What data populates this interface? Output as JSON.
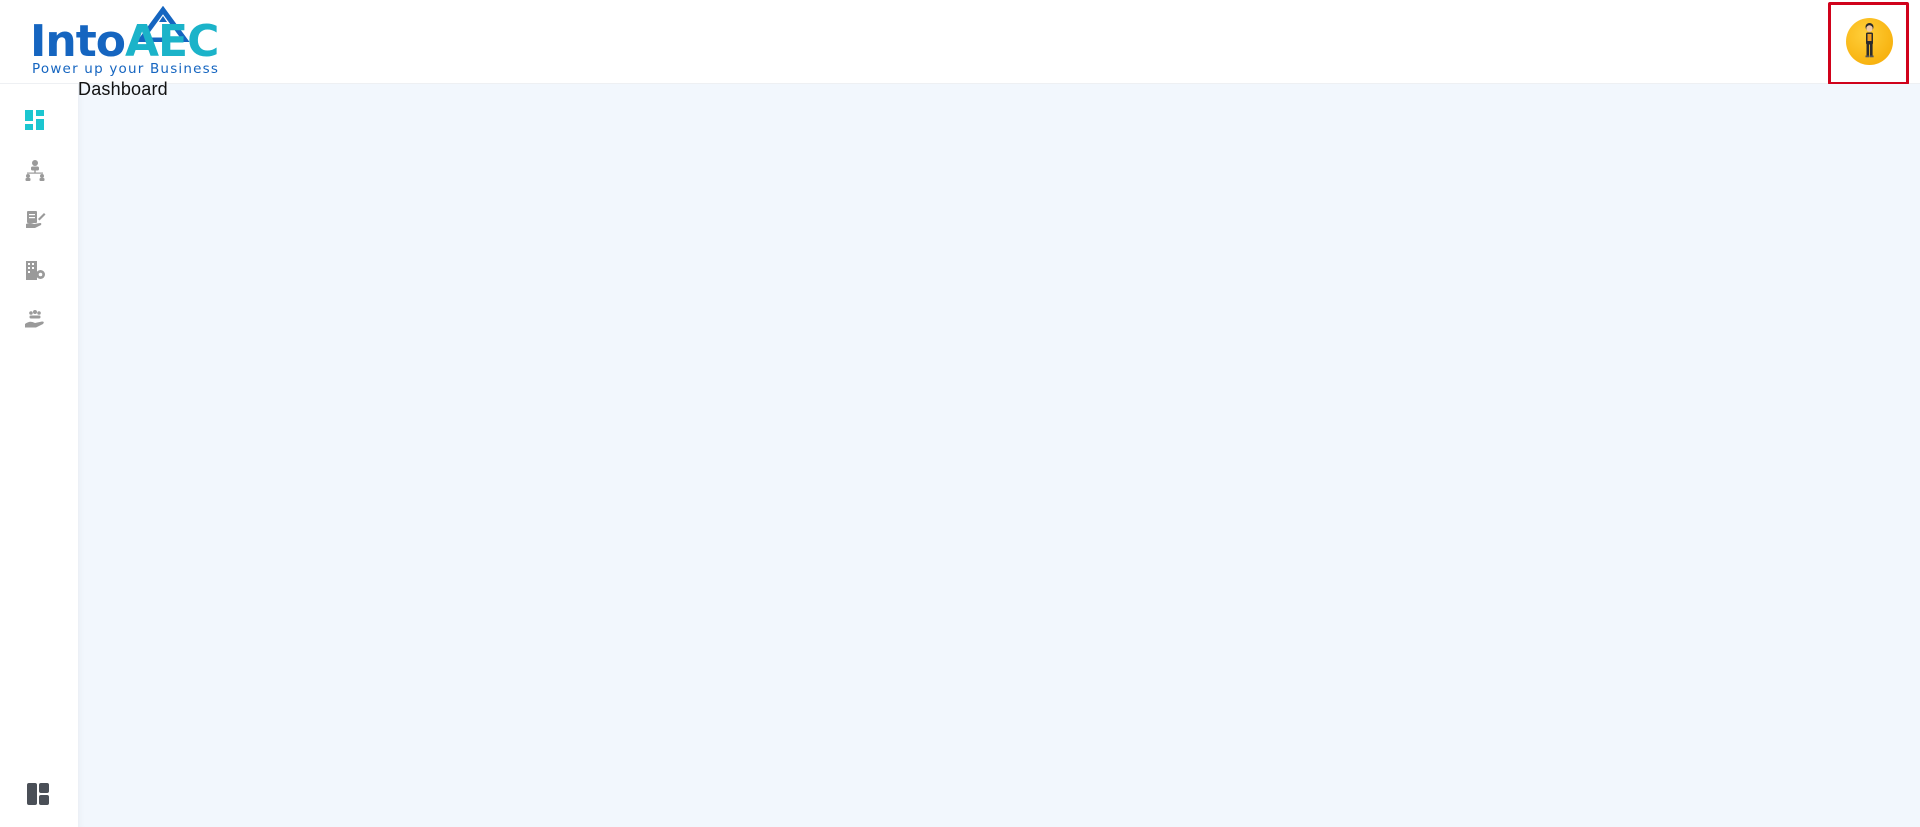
{
  "brand": {
    "name_part1": "Into",
    "name_part2": "AEC",
    "tagline": "Power up your Business",
    "primary_color": "#1565c0",
    "accent_color": "#1bb3c9"
  },
  "header": {
    "avatar_icon": "user-avatar-icon",
    "highlight_color": "#d0021b"
  },
  "page": {
    "title": "Dashboard"
  },
  "sidebar": {
    "active_color": "#1bc6d0",
    "inactive_color": "#9a9a9a",
    "items": [
      {
        "icon": "dashboard-icon",
        "active": true
      },
      {
        "icon": "org-chart-icon",
        "active": false
      },
      {
        "icon": "hand-edit-icon",
        "active": false
      },
      {
        "icon": "building-gear-icon",
        "active": false
      },
      {
        "icon": "hand-people-icon",
        "active": false
      }
    ],
    "bottom_icon": "layout-panels-icon"
  }
}
